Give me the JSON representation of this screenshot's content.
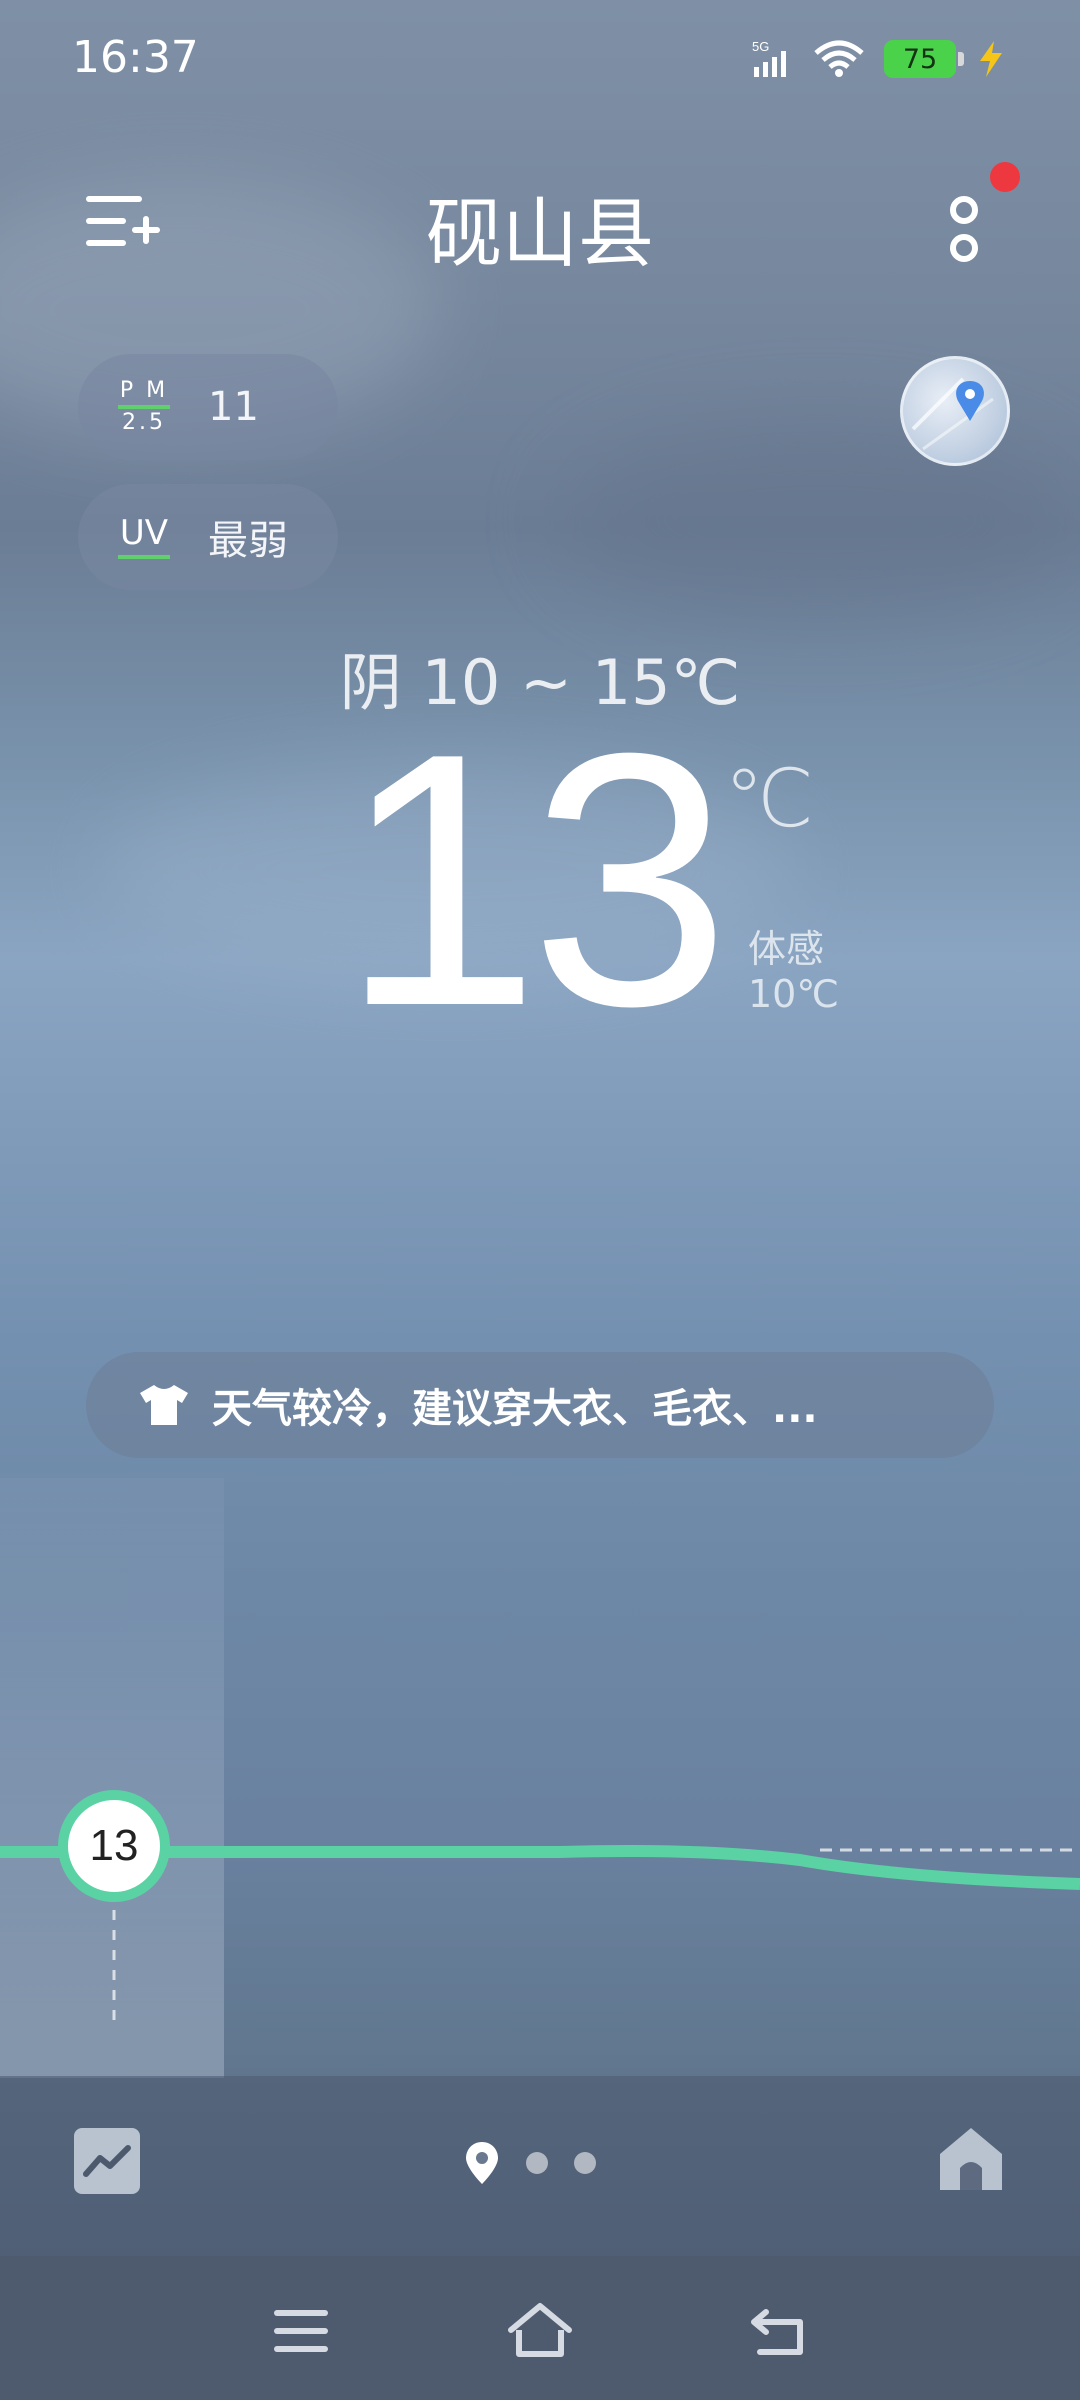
{
  "status_bar": {
    "time": "16:37",
    "network": "5G",
    "battery_percent": "75",
    "charging": true
  },
  "header": {
    "city_name": "砚山县",
    "has_notification": true
  },
  "air": {
    "pm25_label_top": "P M",
    "pm25_label_bottom": "2.5",
    "pm25_value": "11",
    "uv_label": "UV",
    "uv_value": "最弱"
  },
  "current": {
    "condition_line": "阴  10 ~ 15℃",
    "temperature": "13",
    "unit": "℃",
    "feels_like_label": "体感",
    "feels_like_value": "10℃"
  },
  "advice": {
    "icon": "shirt-icon",
    "text": "天气较冷，建议穿大衣、毛衣、..."
  },
  "hourly": {
    "current_temp": "13"
  },
  "toolbar": {
    "pager_pages": 3,
    "current_page": 1
  },
  "colors": {
    "accent": "#5ad2a4",
    "battery": "#4bd24b",
    "notification": "#ee3840"
  }
}
